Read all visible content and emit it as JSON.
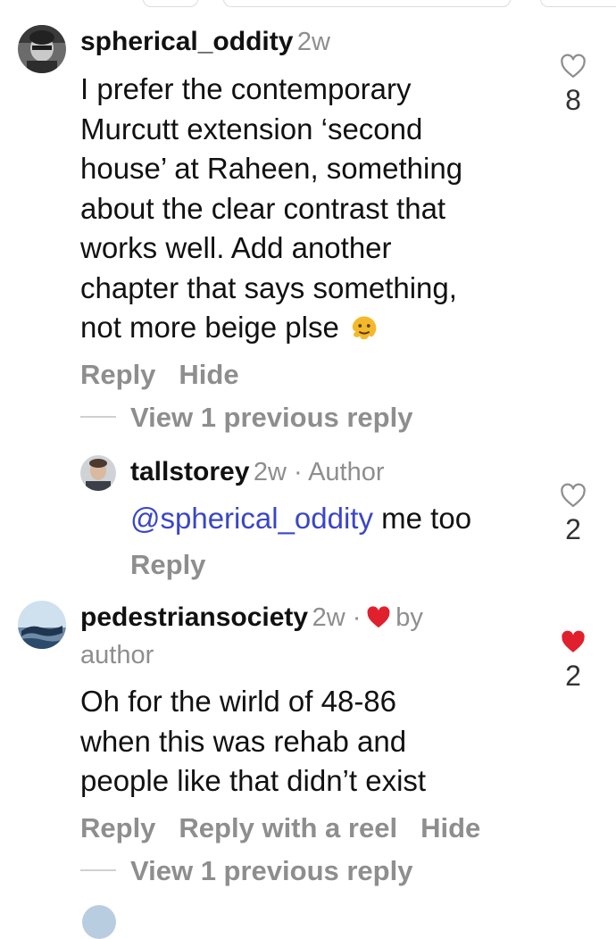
{
  "colors": {
    "text": "#111111",
    "muted": "#8e8e8e",
    "mention": "#3a46c7",
    "heart_liked": "#e0202c"
  },
  "comments": [
    {
      "username": "spherical_oddity",
      "meta": "2w",
      "text_lines": [
        "I prefer the contemporary",
        "Murcutt extension ‘second",
        "house’ at Raheen, something",
        "about the clear contrast that",
        "works well. Add another",
        "chapter that says something,",
        "not more beige plse"
      ],
      "emoji": "melting-face-emoji",
      "actions": [
        "Reply",
        "Hide"
      ],
      "like_count": "8",
      "liked": false,
      "view_replies": "View 1 previous reply"
    },
    {
      "username": "tallstorey",
      "meta": "2w · Author",
      "mention": "@spherical_oddity",
      "text": "me too",
      "actions": [
        "Reply"
      ],
      "like_count": "2",
      "liked": false
    },
    {
      "username": "pedestriansociety",
      "meta": "2w ·",
      "meta_suffix": "by",
      "meta_line2": "author",
      "text_lines": [
        "Oh for the wirld of 48-86",
        "when this was rehab and",
        "people like that didn’t exist"
      ],
      "actions": [
        "Reply",
        "Reply with a reel",
        "Hide"
      ],
      "like_count": "2",
      "liked": true,
      "view_replies": "View 1 previous reply"
    }
  ]
}
